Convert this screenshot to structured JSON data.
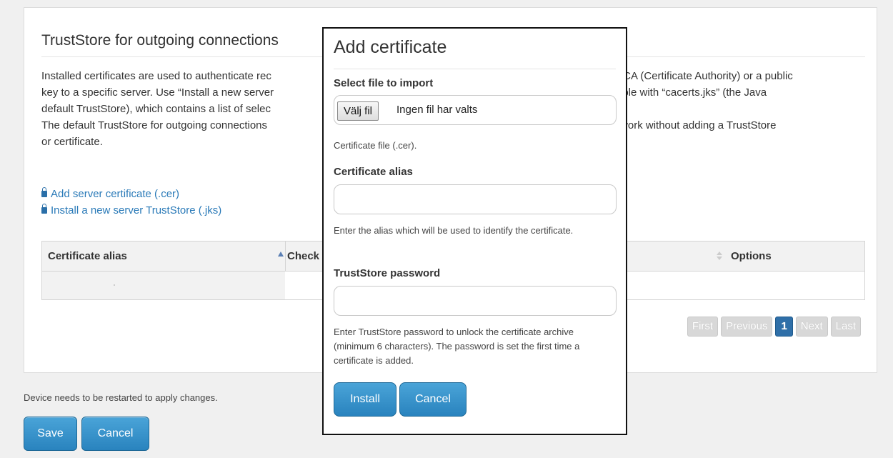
{
  "panel": {
    "title": "TrustStore for outgoing connections",
    "description": [
      "Installed certificates are used to authenticate rec",
      "key to a specific server. Use “Install a new server",
      "default TrustStore), which contains a list of selec",
      "The default TrustStore for outgoing connections",
      "or certificate."
    ],
    "description_right": [
      "to a CA (Certificate Authority) or a public",
      "xample with “cacerts.jks” (the Java",
      "",
      "not work without adding a TrustStore",
      ""
    ],
    "links": {
      "add_cert": "Add server certificate (.cer)",
      "install_truststore": "Install a new server TrustStore (.jks)"
    },
    "table": {
      "col_alias": "Certificate alias",
      "col_check": "Check",
      "col_options": "Options"
    },
    "pager": {
      "first": "First",
      "previous": "Previous",
      "current": "1",
      "next": "Next",
      "last": "Last"
    }
  },
  "footer": {
    "restart_note": "Device needs to be restarted to apply changes.",
    "save_label": "Save",
    "cancel_label": "Cancel"
  },
  "modal": {
    "title": "Add certificate",
    "file_label": "Select file to import",
    "file_button": "Välj fil",
    "file_status": "Ingen fil har valts",
    "file_help": "Certificate file (.cer).",
    "alias_label": "Certificate alias",
    "alias_value": "",
    "alias_help": "Enter the alias which will be used to identify the certificate.",
    "password_label": "TrustStore password",
    "password_value": "",
    "password_help": "Enter TrustStore password to unlock the certificate archive (minimum 6 characters). The password is set the first time a certificate is added.",
    "install_label": "Install",
    "cancel_label": "Cancel"
  },
  "colors": {
    "accent": "#2983be",
    "link": "#2a7ab8",
    "pager_active": "#2f6fa8"
  }
}
